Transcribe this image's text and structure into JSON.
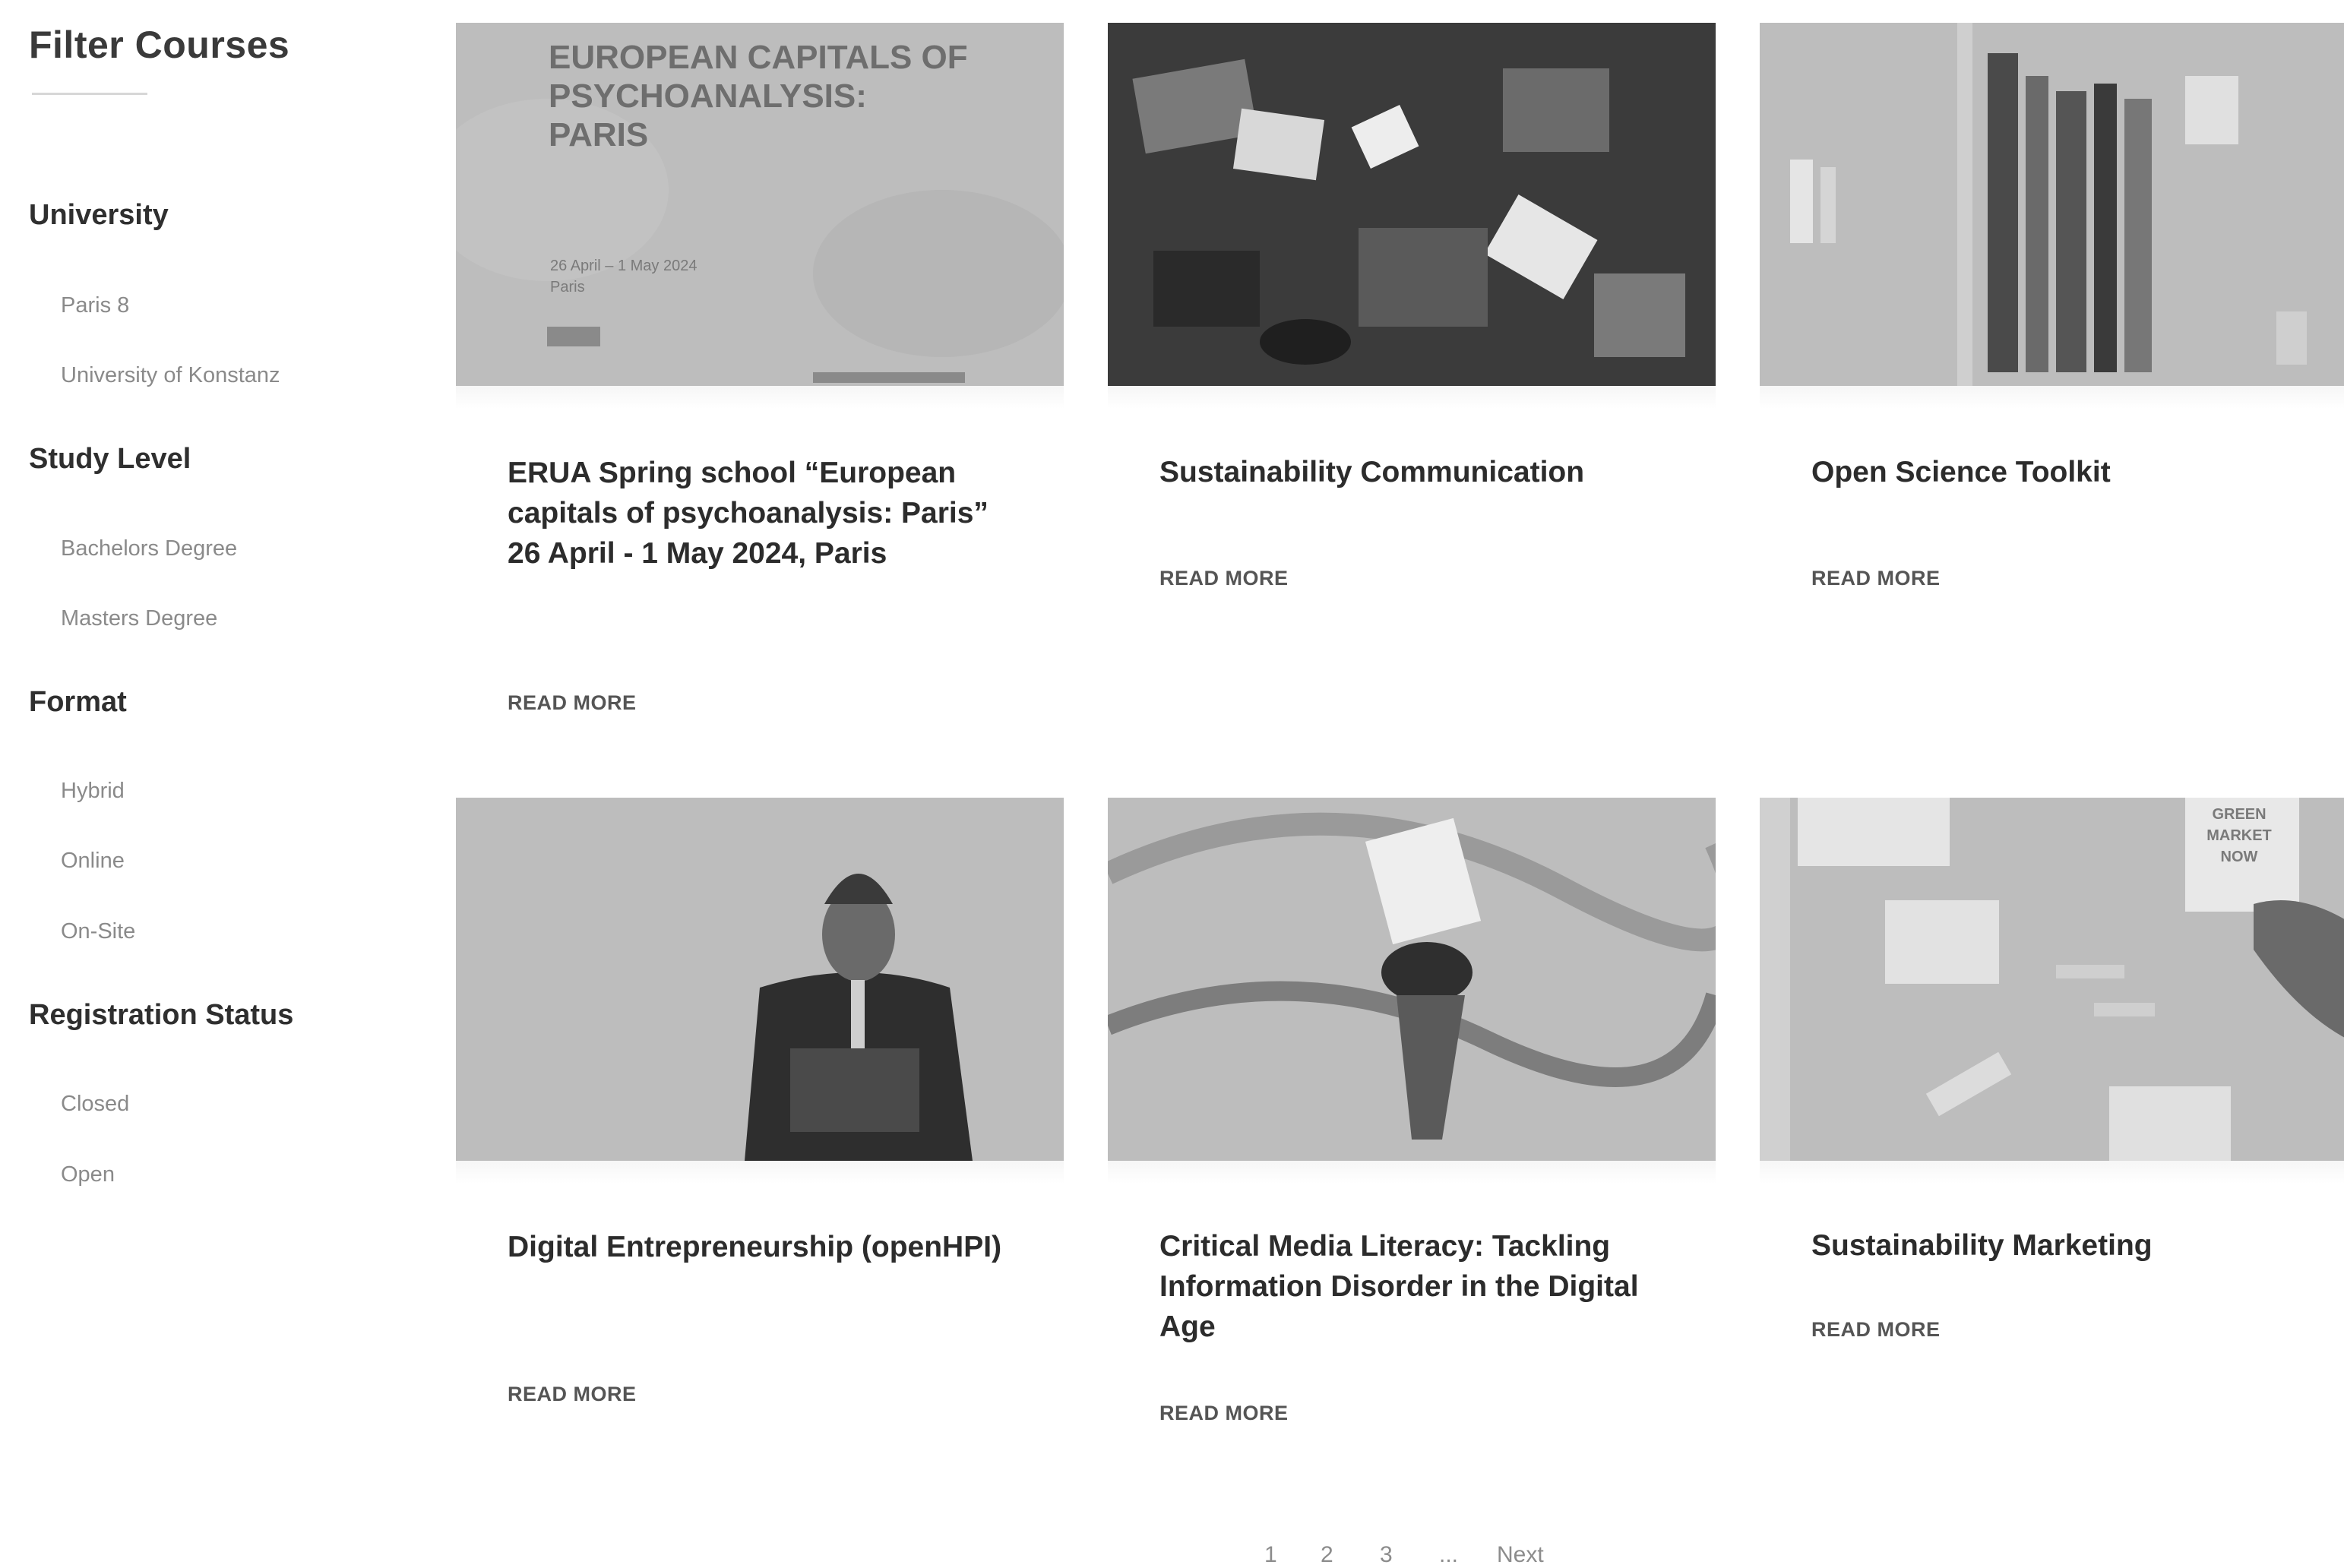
{
  "sidebar": {
    "title": "Filter Courses",
    "groups": [
      {
        "title": "University",
        "options": [
          "Paris 8",
          "University of Konstanz"
        ]
      },
      {
        "title": "Study Level",
        "options": [
          "Bachelors Degree",
          "Masters Degree"
        ]
      },
      {
        "title": "Format",
        "options": [
          "Hybrid",
          "Online",
          "On-Site"
        ]
      },
      {
        "title": "Registration Status",
        "options": [
          "Closed",
          "Open"
        ]
      }
    ]
  },
  "cards": [
    {
      "title": "ERUA Spring school “European capitals of psychoanalysis: Paris” 26 April - 1 May 2024, Paris",
      "read_more": "READ MORE",
      "image": {
        "icon": "poster-image",
        "heading": "EUROPEAN CAPITALS OF PSYCHOANALYSIS: PARIS",
        "date": "26 April – 1 May 2024 Paris"
      }
    },
    {
      "title": "Sustainability Communication",
      "read_more": "READ MORE",
      "image": {
        "icon": "desk-laptops-image"
      }
    },
    {
      "title": "Open Science Toolkit",
      "read_more": "READ MORE",
      "image": {
        "icon": "bookshelf-image"
      }
    },
    {
      "title": "Digital Entrepreneurship (openHPI)",
      "read_more": "READ MORE",
      "image": {
        "icon": "businessman-tablet-image"
      }
    },
    {
      "title": "Critical Media Literacy: Tackling Information Disorder in the Digital Age",
      "read_more": "READ MORE",
      "image": {
        "icon": "swirl-photo-image"
      }
    },
    {
      "title": "Sustainability Marketing",
      "read_more": "READ MORE",
      "image": {
        "icon": "corkboard-image",
        "sign": "GREEN MARKET NOW"
      }
    }
  ],
  "pagination": {
    "pages": [
      "1",
      "2",
      "3"
    ],
    "ellipsis": "...",
    "next": "Next"
  }
}
